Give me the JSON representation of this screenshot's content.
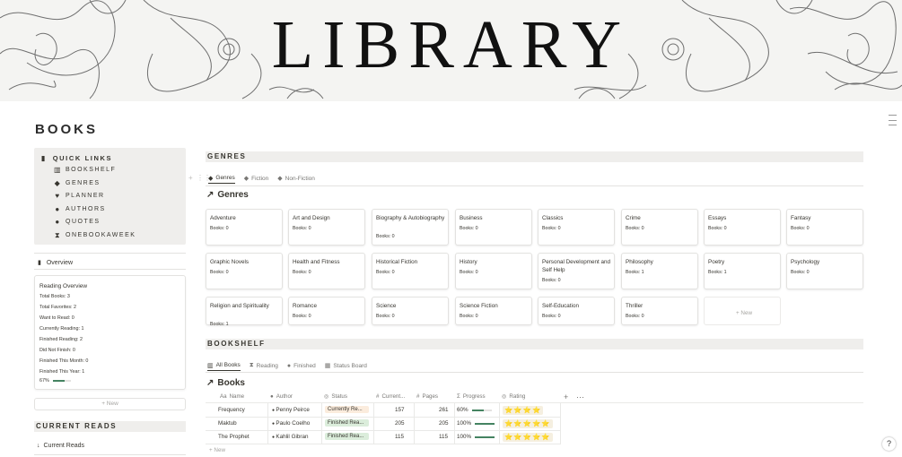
{
  "banner": {
    "title": "LIBRARY"
  },
  "page": {
    "title": "BOOKS"
  },
  "quick_links": {
    "title": "QUICK LINKS",
    "items": [
      {
        "label": "BOOKSHELF",
        "icon": "book-open-icon",
        "glyph": "▥"
      },
      {
        "label": "GENRES",
        "icon": "tag-icon",
        "glyph": "◆"
      },
      {
        "label": "PLANNER",
        "icon": "heart-icon",
        "glyph": "♥"
      },
      {
        "label": "AUTHORS",
        "icon": "person-icon",
        "glyph": "●"
      },
      {
        "label": "QUOTES",
        "icon": "speech-bubble-icon",
        "glyph": "●"
      },
      {
        "label": "ONEBOOKAWEEK",
        "icon": "hourglass-icon",
        "glyph": "⧗"
      }
    ]
  },
  "overview_link": {
    "label": "Overview"
  },
  "reading_overview": {
    "title": "Reading Overview",
    "lines": [
      "Total Books: 3",
      "Total Favorites: 2",
      "Want to Read: 0",
      "Currently Reading: 1",
      "Finished Reading: 2",
      "Did Not Finish: 0",
      "Finished This Month: 0",
      "Finished This Year: 1"
    ],
    "progress_label": "67%",
    "progress_value": 0.67
  },
  "left_new_button": "+ New",
  "current_reads": {
    "header": "CURRENT READS",
    "link": "Current Reads"
  },
  "genres_section": {
    "header": "GENRES",
    "tabs": [
      {
        "label": "Genres",
        "icon": "tag-icon",
        "active": true
      },
      {
        "label": "Fiction",
        "icon": "tag-icon",
        "active": false
      },
      {
        "label": "Non-Fiction",
        "icon": "tag-icon",
        "active": false
      }
    ],
    "view_title": "Genres",
    "cards": [
      {
        "name": "Adventure",
        "count": "Books: 0"
      },
      {
        "name": "Art and Design",
        "count": "Books: 0"
      },
      {
        "name": "Biography & Autobiography",
        "count": "Books: 0"
      },
      {
        "name": "Business",
        "count": "Books: 0"
      },
      {
        "name": "Classics",
        "count": "Books: 0"
      },
      {
        "name": "Crime",
        "count": "Books: 0"
      },
      {
        "name": "Essays",
        "count": "Books: 0"
      },
      {
        "name": "Fantasy",
        "count": "Books: 0"
      },
      {
        "name": "Graphic Novels",
        "count": "Books: 0"
      },
      {
        "name": "Health and Fitness",
        "count": "Books: 0"
      },
      {
        "name": "Historical Fiction",
        "count": "Books: 0"
      },
      {
        "name": "History",
        "count": "Books: 0"
      },
      {
        "name": "Personal Development and Self Help",
        "count": "Books: 0"
      },
      {
        "name": "Philosophy",
        "count": "Books: 1"
      },
      {
        "name": "Poetry",
        "count": "Books: 1"
      },
      {
        "name": "Psychology",
        "count": "Books: 0"
      },
      {
        "name": "Religion and Spirituality",
        "count": "Books: 1"
      },
      {
        "name": "Romance",
        "count": "Books: 0"
      },
      {
        "name": "Science",
        "count": "Books: 0"
      },
      {
        "name": "Science Fiction",
        "count": "Books: 0"
      },
      {
        "name": "Self-Education",
        "count": "Books: 0"
      },
      {
        "name": "Thriller",
        "count": "Books: 0"
      }
    ],
    "new_card_label": "+ New"
  },
  "bookshelf": {
    "header": "BOOKSHELF",
    "tabs": [
      {
        "label": "All Books",
        "icon": "book-open-icon",
        "active": true
      },
      {
        "label": "Reading",
        "icon": "hourglass-icon",
        "active": false
      },
      {
        "label": "Finished",
        "icon": "check-circle-icon",
        "active": false
      },
      {
        "label": "Status Board",
        "icon": "board-icon",
        "active": false
      }
    ],
    "view_title": "Books",
    "columns": [
      {
        "label": "Name",
        "icon": "Aa"
      },
      {
        "label": "Author",
        "icon": "●"
      },
      {
        "label": "Status",
        "icon": "◎"
      },
      {
        "label": "Current...",
        "icon": "#"
      },
      {
        "label": "Pages",
        "icon": "#"
      },
      {
        "label": "Progress",
        "icon": "Σ"
      },
      {
        "label": "Rating",
        "icon": "◎"
      }
    ],
    "rows": [
      {
        "name": "Frequency",
        "author": "Penny Peirce",
        "status": "Currently Re...",
        "status_color": "#fbecdd",
        "current": "157",
        "pages": "261",
        "progress_label": "60%",
        "progress": 0.6,
        "rating": "⭐⭐⭐⭐",
        "stars": 4
      },
      {
        "name": "Maktub",
        "author": "Paulo Coelho",
        "status": "Finished Rea...",
        "status_color": "#dbeddb",
        "current": "205",
        "pages": "205",
        "progress_label": "100%",
        "progress": 1.0,
        "rating": "⭐⭐⭐⭐⭐",
        "stars": 5
      },
      {
        "name": "The Prophet",
        "author": "Kahlil Gibran",
        "status": "Finished Rea...",
        "status_color": "#dbeddb",
        "current": "115",
        "pages": "115",
        "progress_label": "100%",
        "progress": 1.0,
        "rating": "⭐⭐⭐⭐⭐",
        "stars": 5
      }
    ],
    "new_row_label": "+ New"
  }
}
